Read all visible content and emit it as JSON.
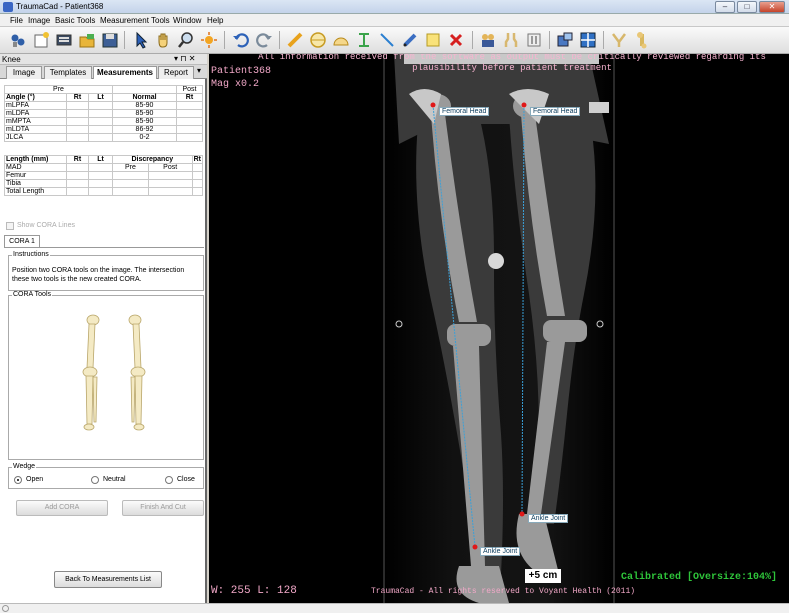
{
  "window": {
    "title": "TraumaCad - Patient368",
    "min": "–",
    "max": "□",
    "close": "✕"
  },
  "menu": [
    "File",
    "Image",
    "Basic Tools",
    "Measurement Tools",
    "Window",
    "Help"
  ],
  "toolbar": {
    "icons": [
      "connect-icon",
      "new-case-icon",
      "monitor-icon",
      "open-folder-icon",
      "save-icon",
      "pointer-icon",
      "pan-hand-icon",
      "zoom-icon",
      "contrast-icon",
      "undo-icon",
      "redo-icon",
      "ruler-icon",
      "circle-icon",
      "angle-icon",
      "caliper-icon",
      "line-icon",
      "pencil-icon",
      "note-icon",
      "delete-icon",
      "people-icon",
      "knee-icon",
      "implant-icon",
      "window-layout-icon",
      "grid-icon",
      "osteotomy-icon",
      "bone-icon"
    ]
  },
  "panel": {
    "title": "Knee",
    "pin": "▾ ⊓ ✕",
    "tabs": [
      "Image",
      "Templates",
      "Measurements",
      "Report"
    ],
    "pre_label": "Pre",
    "post_label": "Post",
    "angle_headers": [
      "Angle (°)",
      "Rt",
      "Lt",
      "Normal",
      "Rt"
    ],
    "angles": [
      [
        "mLPFA",
        "",
        "",
        "85-90",
        ""
      ],
      [
        "mLDFA",
        "",
        "",
        "85-90",
        ""
      ],
      [
        "mMPTA",
        "",
        "",
        "85-90",
        ""
      ],
      [
        "mLDTA",
        "",
        "",
        "86-92",
        ""
      ],
      [
        "JLCA",
        "",
        "",
        "0-2",
        ""
      ]
    ],
    "length_headers": [
      "Length (mm)",
      "Rt",
      "Lt",
      "Discrepancy",
      "Rt"
    ],
    "length_sub": [
      "",
      "",
      "",
      "Pre",
      "Post"
    ],
    "lengths": [
      [
        "MAD",
        "",
        "",
        "",
        ""
      ],
      [
        "Femur",
        "",
        "",
        "",
        ""
      ],
      [
        "Tibia",
        "",
        "",
        "",
        ""
      ],
      [
        "Total Length",
        "",
        "",
        "",
        ""
      ]
    ],
    "show_cora": "Show CORA Lines",
    "cora_tab": "CORA 1",
    "instructions_label": "Instructions",
    "instructions_text": "Position two CORA tools on the image. The intersection these two tools is the new created CORA.",
    "cora_tools_label": "CORA Tools",
    "wedge_label": "Wedge",
    "wedge_options": [
      "Open",
      "Neutral",
      "Close"
    ],
    "add_cora": "Add CORA",
    "finish_cut": "Finish And Cut",
    "back": "Back To Measurements List"
  },
  "viewer": {
    "notice": "All information received from the software as output must be critically reviewed regarding its plausibility before patient treatment",
    "patient": "Patient368",
    "mag": "Mag x0.2",
    "label_fh_right": "Femoral Head",
    "label_fh_left": "Femoral Head",
    "label_aj_right": "Ankle Joint",
    "label_aj_left": "Ankle Joint",
    "scale": "+5 cm",
    "wl": "W: 255 L: 128",
    "calibrated": "Calibrated [Oversize:104%]",
    "copyright": "TraumaCad - All rights reserved to Voyant Health (2011)",
    "line_color": "#3aa0d8",
    "point_color": "#e01818"
  }
}
